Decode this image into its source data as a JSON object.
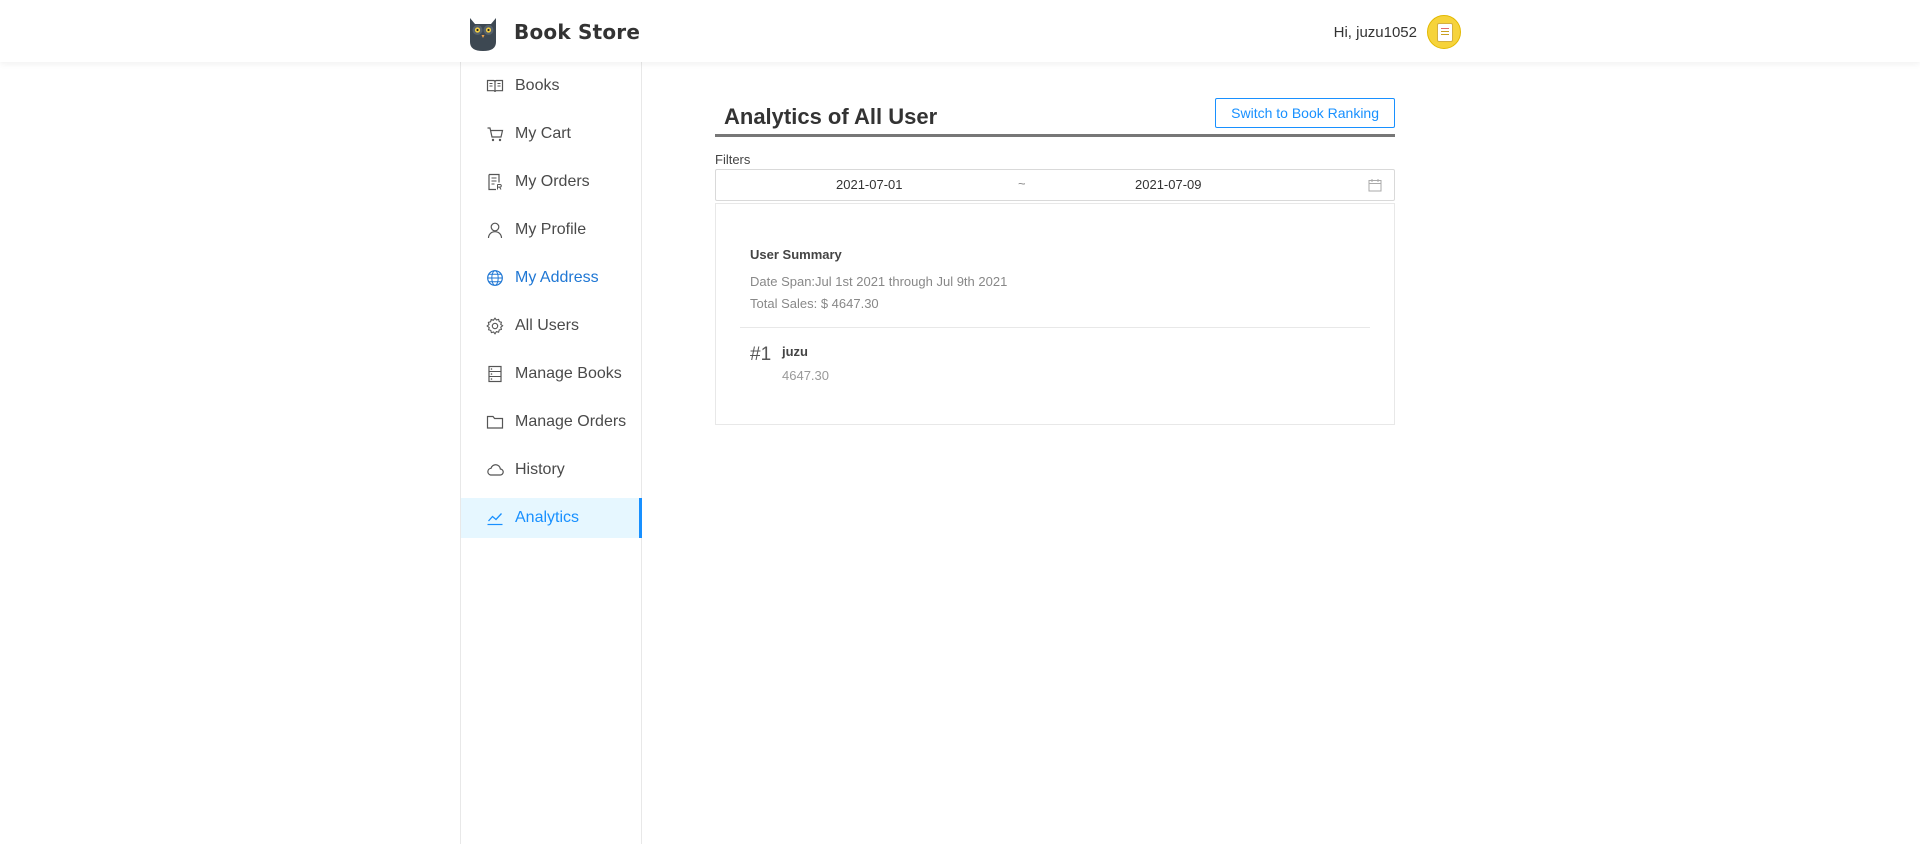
{
  "header": {
    "brand_title": "Book Store",
    "greeting": "Hi, juzu1052"
  },
  "sidebar": {
    "items": [
      {
        "label": "Books",
        "icon": "book-icon"
      },
      {
        "label": "My Cart",
        "icon": "cart-icon"
      },
      {
        "label": "My Orders",
        "icon": "orders-icon"
      },
      {
        "label": "My Profile",
        "icon": "user-icon"
      },
      {
        "label": "My Address",
        "icon": "globe-icon"
      },
      {
        "label": "All Users",
        "icon": "gear-icon"
      },
      {
        "label": "Manage Books",
        "icon": "database-icon"
      },
      {
        "label": "Manage Orders",
        "icon": "folder-icon"
      },
      {
        "label": "History",
        "icon": "cloud-icon"
      },
      {
        "label": "Analytics",
        "icon": "line-chart-icon"
      }
    ],
    "active": "Analytics",
    "link_color": "#1f77d4",
    "active_color": "#1890ff"
  },
  "main": {
    "title": "Analytics of All User",
    "switch_button": "Switch to Book Ranking",
    "filters_label": "Filters",
    "date_range": {
      "start": "2021-07-01",
      "separator": "~",
      "end": "2021-07-09"
    },
    "summary": {
      "title": "User Summary",
      "date_span": "Date Span:Jul 1st 2021 through Jul 9th 2021",
      "total_sales": "Total Sales: $ 4647.30"
    },
    "ranking": [
      {
        "rank": "#1",
        "name": "juzu",
        "value": "4647.30"
      }
    ]
  }
}
